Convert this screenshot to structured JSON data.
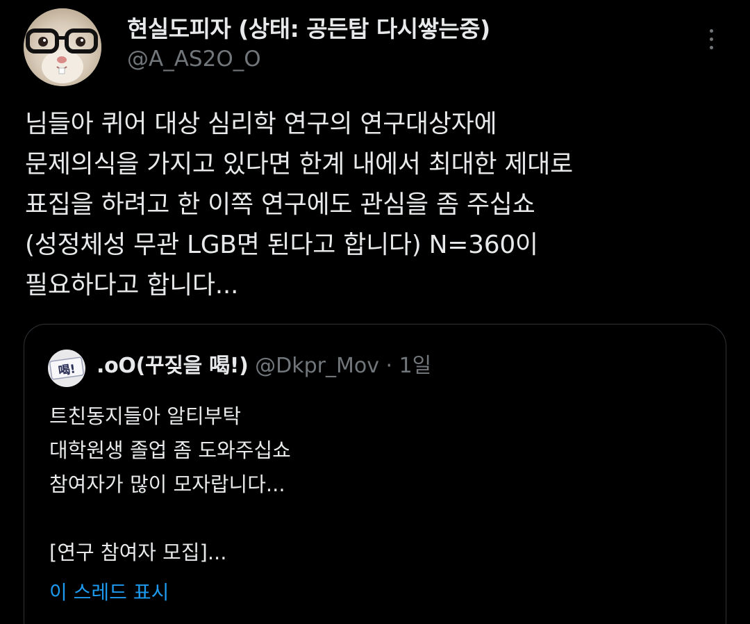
{
  "tweet": {
    "display_name": "현실도피자 (상태: 공든탑 다시쌓는중)",
    "handle": "@A_AS2O_O",
    "body_lines": [
      "님들아 퀴어 대상 심리학 연구의 연구대상자에",
      "문제의식을 가지고 있다면 한계 내에서 최대한 제대로",
      "표집을 하려고 한 이쪽 연구에도 관심을 좀 주십쇼",
      "(성정체성 무관 LGB면 된다고 합니다) N=360이",
      "필요하다고 합니다..."
    ]
  },
  "quote": {
    "avatar_text": "喝!",
    "display_name": ".oO(꾸짖을 喝!)",
    "handle": "@Dkpr_Mov",
    "separator": "·",
    "time": "1일",
    "body_lines": [
      "트친동지들아 알티부탁",
      "대학원생 졸업 좀 도와주십쇼",
      "참여자가 많이 모자랍니다...",
      "",
      "[연구 참여자 모집]..."
    ],
    "show_thread": "이 스레드 표시"
  },
  "colors": {
    "background": "#000000",
    "primary_text": "#e7e9ea",
    "secondary_text": "#71767b",
    "link": "#1d9bf0",
    "border": "#2f3336"
  },
  "icons": {
    "more": "more-vertical-icon"
  }
}
